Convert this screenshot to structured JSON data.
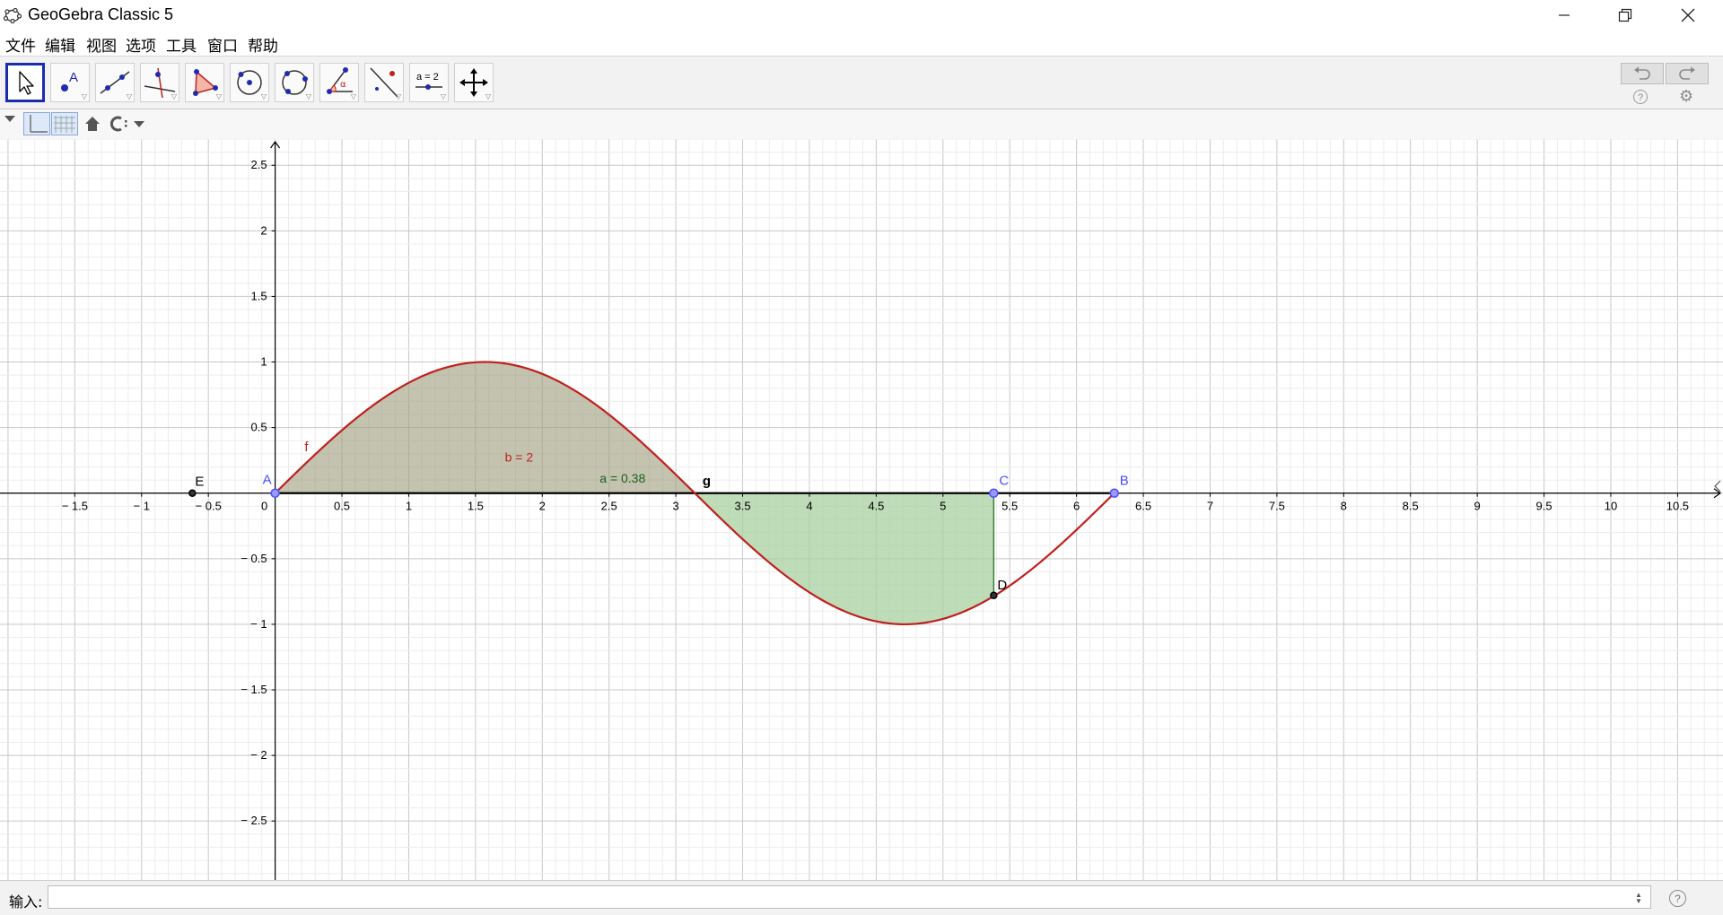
{
  "window": {
    "title": "GeoGebra Classic 5",
    "minimize_icon": "minimize-icon",
    "maximize_icon": "restore-icon",
    "close_icon": "close-icon"
  },
  "menu": [
    "文件",
    "编辑",
    "视图",
    "选项",
    "工具",
    "窗口",
    "帮助"
  ],
  "toolbar": {
    "tools": [
      {
        "name": "move-tool",
        "icon": "arrow-icon",
        "active": true
      },
      {
        "name": "point-tool",
        "icon": "point-icon",
        "label": "A"
      },
      {
        "name": "line-tool",
        "icon": "line-through-points-icon"
      },
      {
        "name": "perpendicular-line-tool",
        "icon": "perpendicular-line-icon"
      },
      {
        "name": "polygon-tool",
        "icon": "polygon-icon"
      },
      {
        "name": "circle-tool",
        "icon": "circle-center-point-icon"
      },
      {
        "name": "circle-three-points-tool",
        "icon": "circle-three-points-icon"
      },
      {
        "name": "angle-tool",
        "icon": "angle-icon",
        "label": "α"
      },
      {
        "name": "reflect-tool",
        "icon": "reflect-about-line-icon"
      },
      {
        "name": "slider-tool",
        "icon": "slider-icon",
        "label": "a = 2"
      },
      {
        "name": "move-graphics-view-tool",
        "icon": "move-graphics-icon"
      }
    ],
    "undo_icon": "undo-icon",
    "redo_icon": "redo-icon",
    "help_icon": "help-icon",
    "settings_icon": "gear-icon"
  },
  "stylebar": {
    "toggle_icon": "stylebar-toggle-icon",
    "axes_icon": "axes-toggle-icon",
    "grid_icon": "grid-toggle-icon",
    "home_icon": "home-icon",
    "point_capture_icon": "point-capture-icon"
  },
  "colors": {
    "curve": "#c0201e",
    "fill_b": "#9b9b7a",
    "fill_a": "#a8d0a0",
    "point_free": "#4d4dff",
    "point_dependent": "#333333",
    "segment_g": "#000000"
  },
  "graphics": {
    "x_ticks": [
      "-1.5",
      "-1",
      "-0.5",
      "0",
      "0.5",
      "1",
      "1.5",
      "2",
      "2.5",
      "3",
      "3.5",
      "4",
      "4.5",
      "5",
      "5.5",
      "6",
      "6.5",
      "7",
      "7.5",
      "8",
      "8.5",
      "9",
      "9.5",
      "10",
      "10.5"
    ],
    "y_ticks": [
      "2.5",
      "2",
      "1.5",
      "1",
      "0.5",
      "-0.5",
      "-1",
      "-1.5",
      "-2",
      "-2.5"
    ],
    "function_label": "f",
    "segment_label": "g",
    "area_b_label": "b = 2",
    "area_a_label": "a = 0.38",
    "points": [
      {
        "label": "A",
        "x": 0,
        "y": 0,
        "kind": "free"
      },
      {
        "label": "B",
        "x": 6.283,
        "y": 0,
        "kind": "free"
      },
      {
        "label": "C",
        "x": 5.38,
        "y": 0,
        "kind": "free"
      },
      {
        "label": "D",
        "x": 5.38,
        "y": -0.78,
        "kind": "dependent"
      },
      {
        "label": "E",
        "x": -0.62,
        "y": 0,
        "kind": "dependent"
      }
    ],
    "function": {
      "expression": "sin(x)",
      "x_range": [
        0,
        6.283
      ]
    },
    "x_view": [
      -2.06,
      10.84
    ],
    "y_view": [
      -2.95,
      2.7
    ]
  },
  "inputbar": {
    "label": "输入:",
    "value": "",
    "help_icon": "help-icon"
  }
}
